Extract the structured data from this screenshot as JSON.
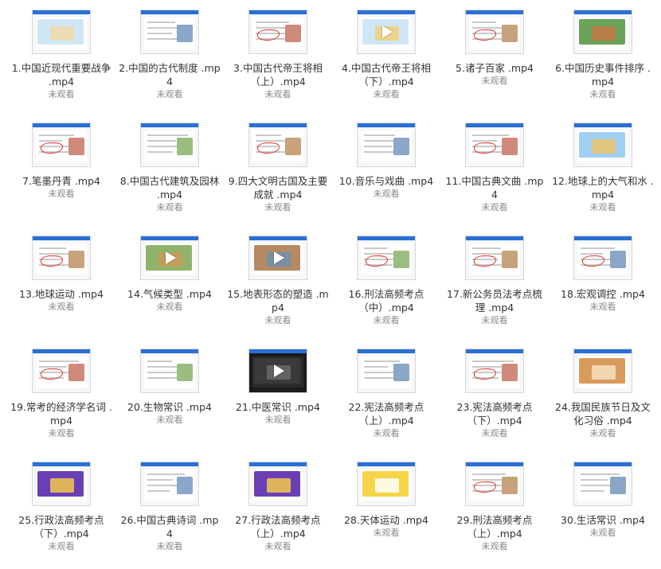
{
  "videos": [
    {
      "title": "1.中国近现代重要战争 .mp4",
      "status": "未观看",
      "thumb": "map"
    },
    {
      "title": "2.中国的古代制度 .mp4",
      "status": "未观看",
      "thumb": "slide-photo"
    },
    {
      "title": "3.中国古代帝王将相（上）.mp4",
      "status": "未观看",
      "thumb": "slide-sketch"
    },
    {
      "title": "4.中国古代帝王将相（下）.mp4",
      "status": "未观看",
      "thumb": "map-play"
    },
    {
      "title": "5.诸子百家 .mp4",
      "status": "未观看",
      "thumb": "slide-portrait"
    },
    {
      "title": "6.中国历史事件排序 .mp4",
      "status": "未观看",
      "thumb": "slide-collage"
    },
    {
      "title": "7.笔墨丹青 .mp4",
      "status": "未观看",
      "thumb": "slide-paint"
    },
    {
      "title": "8.中国古代建筑及园林 .mp4",
      "status": "未观看",
      "thumb": "slide-building"
    },
    {
      "title": "9.四大文明古国及主要成就 .mp4",
      "status": "未观看",
      "thumb": "slide-pyramid"
    },
    {
      "title": "10.音乐与戏曲 .mp4",
      "status": "未观看",
      "thumb": "slide-music"
    },
    {
      "title": "11.中国古典文曲 .mp4",
      "status": "未观看",
      "thumb": "slide-portrait"
    },
    {
      "title": "12.地球上的大气和水 .mp4",
      "status": "未观看",
      "thumb": "world-map"
    },
    {
      "title": "13.地球运动 .mp4",
      "status": "未观看",
      "thumb": "slide-orbit"
    },
    {
      "title": "14.气候类型 .mp4",
      "status": "未观看",
      "thumb": "photo-play"
    },
    {
      "title": "15.地表形态的塑造 .mp4",
      "status": "未观看",
      "thumb": "rock-play"
    },
    {
      "title": "16.刑法高频考点（中）.mp4",
      "status": "未观看",
      "thumb": "slide-notes"
    },
    {
      "title": "17.新公务员法考点梳理 .mp4",
      "status": "未观看",
      "thumb": "slide-text"
    },
    {
      "title": "18.宏观调控 .mp4",
      "status": "未观看",
      "thumb": "slide-notes"
    },
    {
      "title": "19.常考的经济学名词 .mp4",
      "status": "未观看",
      "thumb": "slide-red"
    },
    {
      "title": "20.生物常识 .mp4",
      "status": "未观看",
      "thumb": "slide-bio"
    },
    {
      "title": "21.中医常识 .mp4",
      "status": "未观看",
      "thumb": "dark-play"
    },
    {
      "title": "22.宪法高频考点（上）.mp4",
      "status": "未观看",
      "thumb": "slide-house"
    },
    {
      "title": "23.宪法高频考点（下）.mp4",
      "status": "未观看",
      "thumb": "slide-text"
    },
    {
      "title": "24.我国民族节日及文化习俗 .mp4",
      "status": "未观看",
      "thumb": "slide-food"
    },
    {
      "title": "25.行政法高频考点（下）.mp4",
      "status": "未观看",
      "thumb": "slide-purple"
    },
    {
      "title": "26.中国古典诗词 .mp4",
      "status": "未观看",
      "thumb": "slide-poem"
    },
    {
      "title": "27.行政法高频考点（上）.mp4",
      "status": "未观看",
      "thumb": "slide-purple"
    },
    {
      "title": "28.天体运动 .mp4",
      "status": "未观看",
      "thumb": "slide-flower"
    },
    {
      "title": "29.刑法高频考点（上）.mp4",
      "status": "未观看",
      "thumb": "slide-people"
    },
    {
      "title": "30.生活常识 .mp4",
      "status": "未观看",
      "thumb": "slide-items"
    }
  ]
}
